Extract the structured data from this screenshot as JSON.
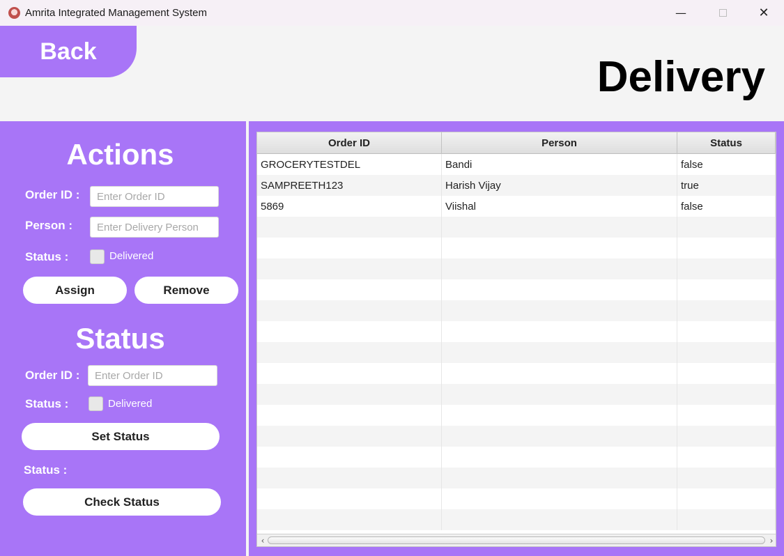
{
  "window": {
    "title": "Amrita Integrated Management System",
    "controls": {
      "minimize": "—",
      "close": "✕"
    }
  },
  "header": {
    "back_label": "Back",
    "page_title": "Delivery"
  },
  "actions": {
    "title": "Actions",
    "order_id_label": "Order ID :",
    "order_id_placeholder": "Enter Order ID",
    "order_id_value": "",
    "person_label": "Person :",
    "person_placeholder": "Enter Delivery Person",
    "person_value": "",
    "status_label": "Status :",
    "delivered_label": "Delivered",
    "delivered_checked": false,
    "assign_label": "Assign",
    "remove_label": "Remove"
  },
  "status_section": {
    "title": "Status",
    "order_id_label": "Order ID :",
    "order_id_placeholder": "Enter Order ID",
    "order_id_value": "",
    "status_label": "Status :",
    "delivered_label": "Delivered",
    "delivered_checked": false,
    "set_status_label": "Set Status",
    "result_label": "Status :",
    "result_value": "",
    "check_status_label": "Check Status"
  },
  "table": {
    "columns": [
      "Order ID",
      "Person",
      "Status"
    ],
    "rows": [
      [
        "GROCERYTESTDEL",
        "Bandi",
        "false"
      ],
      [
        "SAMPREETH123",
        "Harish Vijay",
        "true"
      ],
      [
        "5869",
        "Viishal",
        "false"
      ]
    ],
    "scroll_left": "‹",
    "scroll_right": "›"
  },
  "colors": {
    "accent": "#a875f7",
    "background": "#f4f4f4",
    "button": "#ffffff"
  }
}
